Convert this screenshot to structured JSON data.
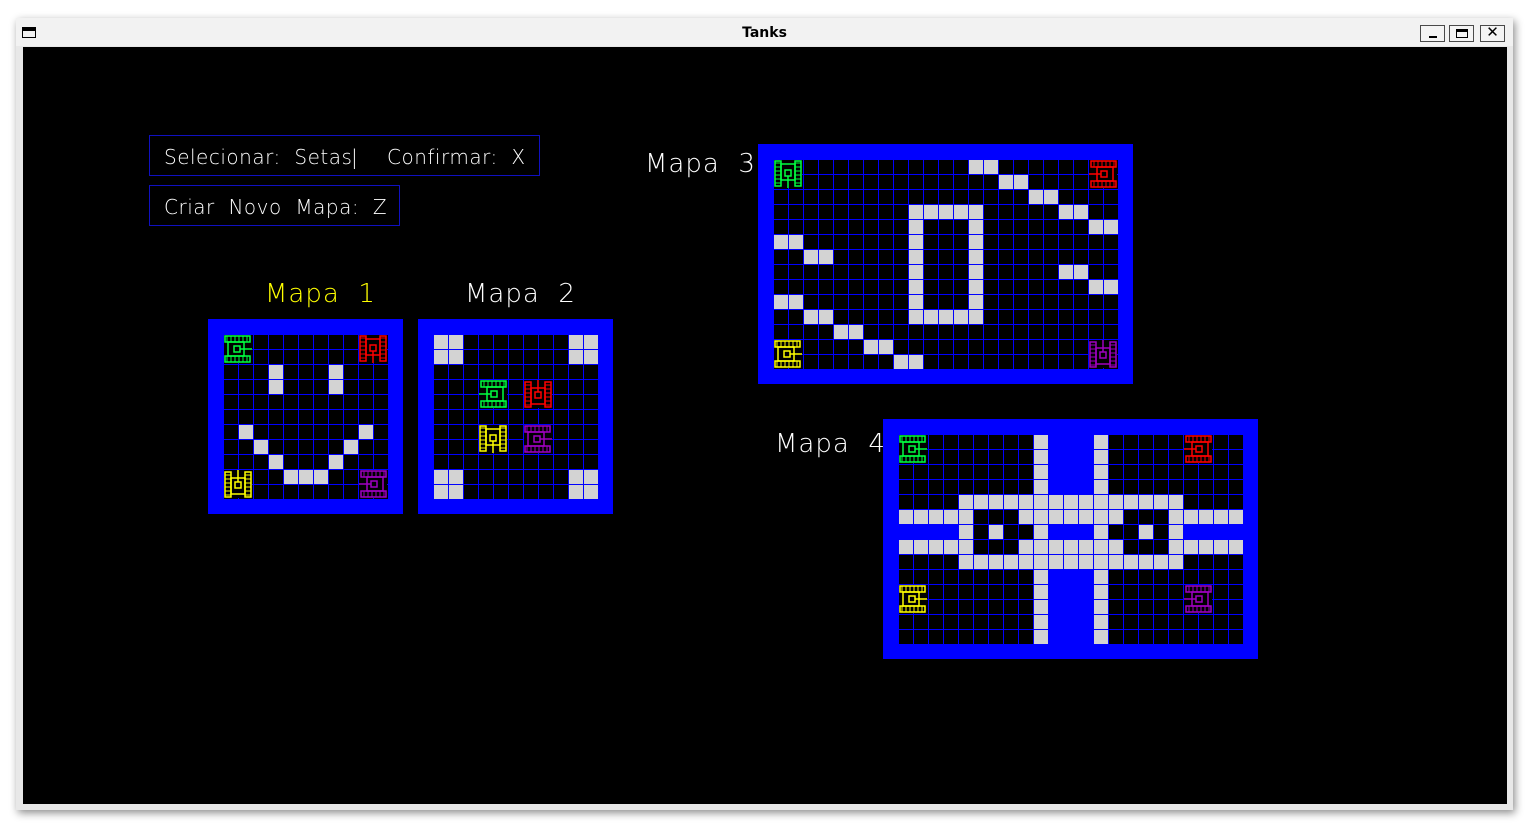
{
  "window": {
    "title": "Tanks"
  },
  "controls": {
    "select_label": "Selecionar:  Setas",
    "separator": "|",
    "confirm_label": "Confirmar:  X",
    "create_label": "Criar  Novo  Mapa:  Z"
  },
  "colors": {
    "wall": "#0000ff",
    "grid": "#0000ff",
    "floor": "#000080",
    "obstacle": "#d3d3d3",
    "selected_label": "#ffff00",
    "label": "#ffffff",
    "tank_green": "#00ff40",
    "tank_red": "#ff0000",
    "tank_yellow": "#ffff00",
    "tank_purple": "#a000c0"
  },
  "maps": [
    {
      "label": "Mapa  1",
      "selected": true,
      "cols": 13,
      "rows": 13,
      "obstacles": [
        [
          4,
          3
        ],
        [
          8,
          3
        ],
        [
          4,
          4
        ],
        [
          8,
          4
        ],
        [
          2,
          7
        ],
        [
          10,
          7
        ],
        [
          3,
          8
        ],
        [
          9,
          8
        ],
        [
          4,
          9
        ],
        [
          8,
          9
        ],
        [
          5,
          10
        ],
        [
          6,
          10
        ],
        [
          7,
          10
        ]
      ],
      "tanks": [
        {
          "color": "green",
          "facing": "right",
          "cell": [
            1,
            1
          ]
        },
        {
          "color": "red",
          "facing": "down",
          "cell": [
            10,
            1
          ]
        },
        {
          "color": "yellow",
          "facing": "up",
          "cell": [
            1,
            10
          ]
        },
        {
          "color": "purple",
          "facing": "left",
          "cell": [
            10,
            10
          ]
        }
      ]
    },
    {
      "label": "Mapa  2",
      "selected": false,
      "cols": 13,
      "rows": 13,
      "obstacles": [
        [
          1,
          1
        ],
        [
          2,
          1
        ],
        [
          1,
          2
        ],
        [
          2,
          2
        ],
        [
          10,
          1
        ],
        [
          11,
          1
        ],
        [
          10,
          2
        ],
        [
          11,
          2
        ],
        [
          1,
          10
        ],
        [
          2,
          10
        ],
        [
          1,
          11
        ],
        [
          2,
          11
        ],
        [
          10,
          10
        ],
        [
          11,
          10
        ],
        [
          10,
          11
        ],
        [
          11,
          11
        ]
      ],
      "tanks": [
        {
          "color": "green",
          "facing": "left",
          "cell": [
            4,
            4
          ]
        },
        {
          "color": "red",
          "facing": "up",
          "cell": [
            7,
            4
          ]
        },
        {
          "color": "yellow",
          "facing": "down",
          "cell": [
            4,
            7
          ]
        },
        {
          "color": "purple",
          "facing": "right",
          "cell": [
            7,
            7
          ]
        }
      ]
    },
    {
      "label": "Mapa  3",
      "selected": false,
      "cols": 25,
      "rows": 16,
      "obstacles": [
        [
          14,
          1
        ],
        [
          15,
          1
        ],
        [
          16,
          2
        ],
        [
          17,
          2
        ],
        [
          18,
          3
        ],
        [
          19,
          3
        ],
        [
          20,
          4
        ],
        [
          21,
          4
        ],
        [
          22,
          5
        ],
        [
          23,
          5
        ],
        [
          1,
          6
        ],
        [
          2,
          6
        ],
        [
          3,
          7
        ],
        [
          4,
          7
        ],
        [
          20,
          8
        ],
        [
          21,
          8
        ],
        [
          22,
          9
        ],
        [
          23,
          9
        ],
        [
          1,
          10
        ],
        [
          2,
          10
        ],
        [
          3,
          11
        ],
        [
          4,
          11
        ],
        [
          5,
          12
        ],
        [
          6,
          12
        ],
        [
          7,
          13
        ],
        [
          8,
          13
        ],
        [
          9,
          14
        ],
        [
          10,
          14
        ],
        [
          10,
          4
        ],
        [
          11,
          4
        ],
        [
          12,
          4
        ],
        [
          13,
          4
        ],
        [
          14,
          4
        ],
        [
          10,
          5
        ],
        [
          10,
          6
        ],
        [
          10,
          7
        ],
        [
          10,
          8
        ],
        [
          10,
          9
        ],
        [
          10,
          10
        ],
        [
          10,
          11
        ],
        [
          11,
          11
        ],
        [
          12,
          11
        ],
        [
          13,
          11
        ],
        [
          14,
          11
        ],
        [
          14,
          5
        ],
        [
          14,
          6
        ],
        [
          14,
          7
        ],
        [
          14,
          8
        ],
        [
          14,
          9
        ],
        [
          14,
          10
        ]
      ],
      "tanks": [
        {
          "color": "green",
          "facing": "down",
          "cell": [
            1,
            1
          ]
        },
        {
          "color": "red",
          "facing": "left",
          "cell": [
            22,
            1
          ]
        },
        {
          "color": "yellow",
          "facing": "right",
          "cell": [
            1,
            13
          ]
        },
        {
          "color": "purple",
          "facing": "up",
          "cell": [
            22,
            13
          ]
        }
      ]
    },
    {
      "label": "Mapa  4",
      "selected": false,
      "cols": 25,
      "rows": 16,
      "obstacles": [
        [
          10,
          1
        ],
        [
          14,
          1
        ],
        [
          10,
          2
        ],
        [
          14,
          2
        ],
        [
          10,
          3
        ],
        [
          14,
          3
        ],
        [
          10,
          4
        ],
        [
          14,
          4
        ],
        [
          5,
          5
        ],
        [
          6,
          5
        ],
        [
          7,
          5
        ],
        [
          8,
          5
        ],
        [
          9,
          5
        ],
        [
          10,
          5
        ],
        [
          11,
          5
        ],
        [
          12,
          5
        ],
        [
          13,
          5
        ],
        [
          14,
          5
        ],
        [
          15,
          5
        ],
        [
          16,
          5
        ],
        [
          17,
          5
        ],
        [
          18,
          5
        ],
        [
          19,
          5
        ],
        [
          1,
          6
        ],
        [
          2,
          6
        ],
        [
          3,
          6
        ],
        [
          4,
          6
        ],
        [
          5,
          6
        ],
        [
          9,
          6
        ],
        [
          10,
          6
        ],
        [
          11,
          6
        ],
        [
          12,
          6
        ],
        [
          13,
          6
        ],
        [
          14,
          6
        ],
        [
          15,
          6
        ],
        [
          19,
          6
        ],
        [
          20,
          6
        ],
        [
          21,
          6
        ],
        [
          22,
          6
        ],
        [
          23,
          6
        ],
        [
          5,
          7
        ],
        [
          7,
          7
        ],
        [
          10,
          7
        ],
        [
          14,
          7
        ],
        [
          17,
          7
        ],
        [
          19,
          7
        ],
        [
          1,
          8
        ],
        [
          2,
          8
        ],
        [
          3,
          8
        ],
        [
          4,
          8
        ],
        [
          5,
          8
        ],
        [
          9,
          8
        ],
        [
          10,
          8
        ],
        [
          11,
          8
        ],
        [
          12,
          8
        ],
        [
          13,
          8
        ],
        [
          14,
          8
        ],
        [
          15,
          8
        ],
        [
          19,
          8
        ],
        [
          20,
          8
        ],
        [
          21,
          8
        ],
        [
          22,
          8
        ],
        [
          23,
          8
        ],
        [
          5,
          9
        ],
        [
          6,
          9
        ],
        [
          7,
          9
        ],
        [
          8,
          9
        ],
        [
          9,
          9
        ],
        [
          10,
          9
        ],
        [
          11,
          9
        ],
        [
          12,
          9
        ],
        [
          13,
          9
        ],
        [
          14,
          9
        ],
        [
          15,
          9
        ],
        [
          16,
          9
        ],
        [
          17,
          9
        ],
        [
          18,
          9
        ],
        [
          19,
          9
        ],
        [
          10,
          10
        ],
        [
          14,
          10
        ],
        [
          10,
          11
        ],
        [
          14,
          11
        ],
        [
          10,
          12
        ],
        [
          14,
          12
        ],
        [
          10,
          13
        ],
        [
          14,
          13
        ],
        [
          10,
          14
        ],
        [
          14,
          14
        ]
      ],
      "blue_fill": [
        [
          11,
          1
        ],
        [
          12,
          1
        ],
        [
          13,
          1
        ],
        [
          11,
          2
        ],
        [
          12,
          2
        ],
        [
          13,
          2
        ],
        [
          11,
          3
        ],
        [
          12,
          3
        ],
        [
          13,
          3
        ],
        [
          11,
          4
        ],
        [
          12,
          4
        ],
        [
          13,
          4
        ],
        [
          1,
          7
        ],
        [
          2,
          7
        ],
        [
          3,
          7
        ],
        [
          4,
          7
        ],
        [
          20,
          7
        ],
        [
          21,
          7
        ],
        [
          22,
          7
        ],
        [
          23,
          7
        ],
        [
          11,
          7
        ],
        [
          12,
          7
        ],
        [
          13,
          7
        ],
        [
          11,
          10
        ],
        [
          12,
          10
        ],
        [
          13,
          10
        ],
        [
          11,
          11
        ],
        [
          12,
          11
        ],
        [
          13,
          11
        ],
        [
          11,
          12
        ],
        [
          12,
          12
        ],
        [
          13,
          12
        ],
        [
          11,
          13
        ],
        [
          12,
          13
        ],
        [
          13,
          13
        ],
        [
          11,
          14
        ],
        [
          12,
          14
        ],
        [
          13,
          14
        ]
      ],
      "tanks": [
        {
          "color": "green",
          "facing": "right",
          "cell": [
            1,
            1
          ]
        },
        {
          "color": "red",
          "facing": "left",
          "cell": [
            20,
            1
          ]
        },
        {
          "color": "yellow",
          "facing": "right",
          "cell": [
            1,
            11
          ]
        },
        {
          "color": "purple",
          "facing": "left",
          "cell": [
            20,
            11
          ]
        }
      ]
    }
  ]
}
